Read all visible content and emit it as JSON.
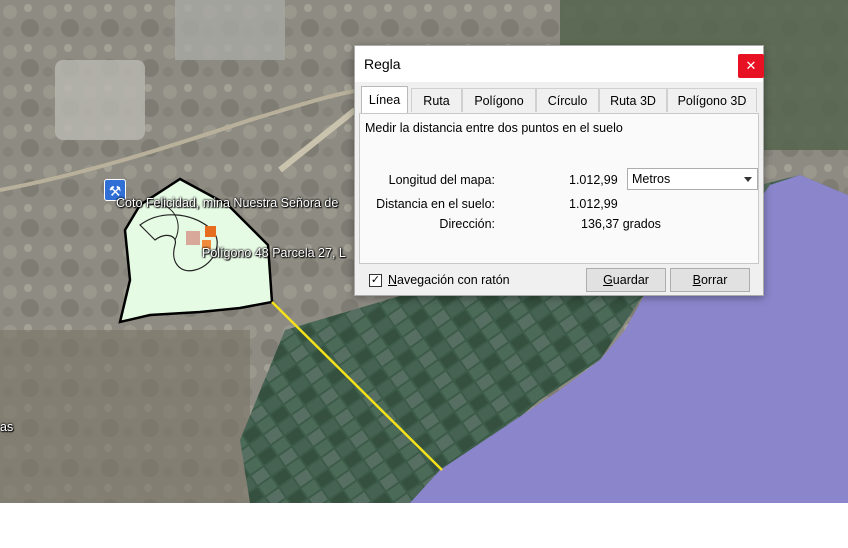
{
  "map": {
    "labels": {
      "mine": "Coto Felicidad, mina Nuestra Señora de",
      "parcel": "Polígono 48 Parcela 27, L",
      "edge": "as"
    },
    "icons": {
      "mine": "mine-pickaxe-icon"
    },
    "colors": {
      "polygon_fill": "#e6fbe4",
      "polygon_stroke": "#000000",
      "measure_line": "#f5e21a",
      "water": "#8b86cc"
    }
  },
  "dialog": {
    "title": "Regla",
    "close_label": "✕",
    "tabs": [
      "Línea",
      "Ruta",
      "Polígono",
      "Círculo",
      "Ruta 3D",
      "Polígono 3D"
    ],
    "active_tab": "Línea",
    "description": "Medir la distancia entre dos puntos en el suelo",
    "map_length": {
      "label": "Longitud del mapa:",
      "value": "1.012,99"
    },
    "unit": {
      "selected": "Metros"
    },
    "ground_distance": {
      "label": "Distancia en el suelo:",
      "value": "1.012,99"
    },
    "direction": {
      "label": "Dirección:",
      "value": "136,37 grados"
    },
    "mouse_navigation": {
      "checked": true,
      "check_mark": "✓",
      "label_first": "N",
      "label_rest": "avegación con ratón"
    },
    "buttons": {
      "save": {
        "accel": "G",
        "rest": "uardar"
      },
      "clear": {
        "accel": "B",
        "rest": "orrar"
      }
    },
    "colors": {
      "close_bg": "#e81123"
    }
  }
}
